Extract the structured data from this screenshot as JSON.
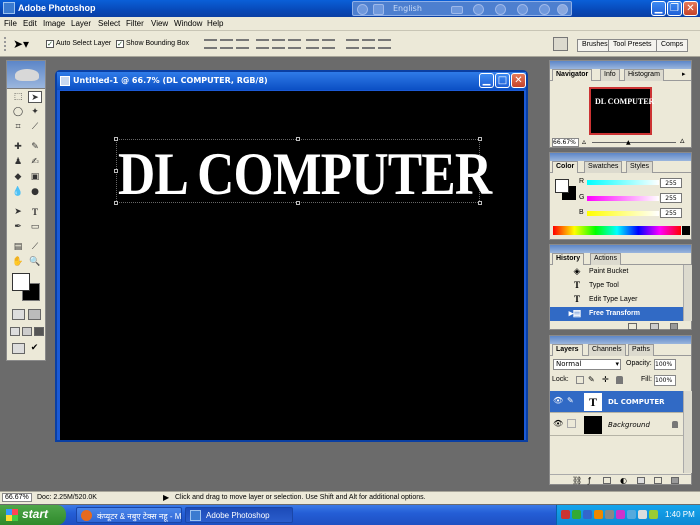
{
  "app": {
    "title": "Adobe Photoshop"
  },
  "langbar": {
    "language": "English"
  },
  "menu": [
    "File",
    "Edit",
    "Image",
    "Layer",
    "Select",
    "Filter",
    "View",
    "Window",
    "Help"
  ],
  "options": {
    "auto_select_label": "Auto Select Layer",
    "auto_select_checked": true,
    "bounding_box_label": "Show Bounding Box",
    "bounding_box_checked": true,
    "well_tabs": [
      "Brushes",
      "Tool Presets",
      "Comps"
    ]
  },
  "document": {
    "title": "Untitled-1 @ 66.7% (DL COMPUTER, RGB/8)",
    "canvas_text": "DL COMPUTER",
    "canvas_bg": "#000000",
    "text_color": "#ffffff"
  },
  "navigator": {
    "tabs": [
      "Navigator",
      "Info",
      "Histogram"
    ],
    "zoom": "66.67%",
    "thumb_text": "DL COMPUTER"
  },
  "color": {
    "tabs": [
      "Color",
      "Swatches",
      "Styles"
    ],
    "channels": [
      {
        "label": "R",
        "value": "255"
      },
      {
        "label": "G",
        "value": "255"
      },
      {
        "label": "B",
        "value": "255"
      }
    ]
  },
  "history": {
    "tabs": [
      "History",
      "Actions"
    ],
    "items": [
      {
        "icon": "paint-bucket-icon",
        "label": "Paint Bucket"
      },
      {
        "icon": "type-icon",
        "label": "Type Tool"
      },
      {
        "icon": "type-icon",
        "label": "Edit Type Layer"
      },
      {
        "icon": "transform-icon",
        "label": "Free Transform"
      }
    ],
    "selected_index": 3
  },
  "layers": {
    "tabs": [
      "Layers",
      "Channels",
      "Paths"
    ],
    "blend_mode": "Normal",
    "opacity_label": "Opacity:",
    "opacity": "100%",
    "lock_label": "Lock:",
    "fill_label": "Fill:",
    "fill": "100%",
    "items": [
      {
        "name": "DL COMPUTER",
        "kind": "text"
      },
      {
        "name": "Background",
        "kind": "image"
      }
    ]
  },
  "status": {
    "zoom": "66.67%",
    "doc": "Doc: 2.25M/520.0K",
    "hint": "Click and drag to move layer or selection.  Use Shift and Alt for additional options."
  },
  "taskbar": {
    "start": "start",
    "tasks": [
      "कंप्यूटर & नबुए टेक्स नहू - Moz...",
      "Adobe Photoshop"
    ],
    "clock": "1:40 PM"
  }
}
